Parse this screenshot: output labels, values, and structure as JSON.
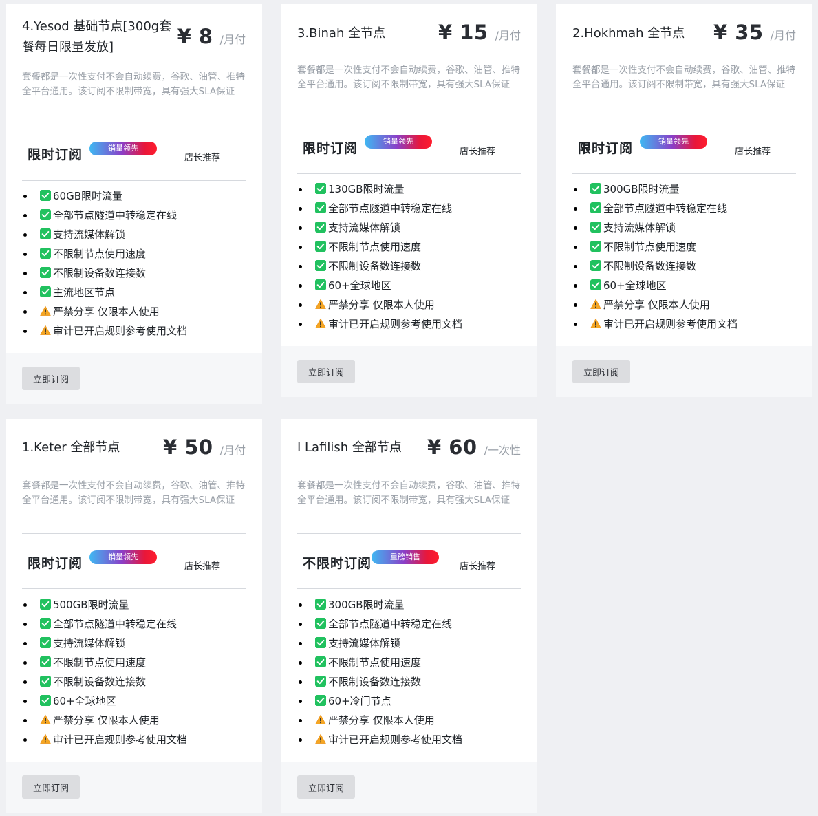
{
  "plans": [
    {
      "title": "4.Yesod 基础节点[300g套餐每日限量发放]",
      "price": "¥ 8",
      "unit": "/月付",
      "description": "套餐都是一次性支付不会自动续费，谷歌、油管、推特全平台通用。该订阅不限制带宽，具有强大SLA保证",
      "promo_label": "限时订阅",
      "badge": "销量领先",
      "recommend": "店长推荐",
      "features": [
        {
          "icon": "check-icon",
          "text": "60GB限时流量"
        },
        {
          "icon": "check-icon",
          "text": "全部节点隧道中转稳定在线"
        },
        {
          "icon": "check-icon",
          "text": "支持流媒体解锁"
        },
        {
          "icon": "check-icon",
          "text": "不限制节点使用速度"
        },
        {
          "icon": "check-icon",
          "text": "不限制设备数连接数"
        },
        {
          "icon": "check-icon",
          "text": "主流地区节点"
        },
        {
          "icon": "warning-icon",
          "text": "严禁分享 仅限本人使用"
        },
        {
          "icon": "warning-icon",
          "text": "审计已开启规则参考使用文档"
        }
      ],
      "button": "立即订阅"
    },
    {
      "title": "3.Binah 全节点",
      "price": "¥ 15",
      "unit": "/月付",
      "description": "套餐都是一次性支付不会自动续费，谷歌、油管、推特全平台通用。该订阅不限制带宽，具有强大SLA保证",
      "promo_label": "限时订阅",
      "badge": "销量领先",
      "recommend": "店长推荐",
      "features": [
        {
          "icon": "check-icon",
          "text": "130GB限时流量"
        },
        {
          "icon": "check-icon",
          "text": "全部节点隧道中转稳定在线"
        },
        {
          "icon": "check-icon",
          "text": "支持流媒体解锁"
        },
        {
          "icon": "check-icon",
          "text": "不限制节点使用速度"
        },
        {
          "icon": "check-icon",
          "text": "不限制设备数连接数"
        },
        {
          "icon": "check-icon",
          "text": "60+全球地区"
        },
        {
          "icon": "warning-icon",
          "text": "严禁分享 仅限本人使用"
        },
        {
          "icon": "warning-icon",
          "text": "审计已开启规则参考使用文档"
        }
      ],
      "button": "立即订阅"
    },
    {
      "title": "2.Hokhmah 全节点",
      "price": "¥ 35",
      "unit": "/月付",
      "description": "套餐都是一次性支付不会自动续费，谷歌、油管、推特全平台通用。该订阅不限制带宽，具有强大SLA保证",
      "promo_label": "限时订阅",
      "badge": "销量领先",
      "recommend": "店长推荐",
      "features": [
        {
          "icon": "check-icon",
          "text": "300GB限时流量"
        },
        {
          "icon": "check-icon",
          "text": "全部节点隧道中转稳定在线"
        },
        {
          "icon": "check-icon",
          "text": "支持流媒体解锁"
        },
        {
          "icon": "check-icon",
          "text": "不限制节点使用速度"
        },
        {
          "icon": "check-icon",
          "text": "不限制设备数连接数"
        },
        {
          "icon": "check-icon",
          "text": "60+全球地区"
        },
        {
          "icon": "warning-icon",
          "text": "严禁分享 仅限本人使用"
        },
        {
          "icon": "warning-icon",
          "text": "审计已开启规则参考使用文档"
        }
      ],
      "button": "立即订阅"
    },
    {
      "title": "1.Keter 全部节点",
      "price": "¥ 50",
      "unit": "/月付",
      "description": "套餐都是一次性支付不会自动续费，谷歌、油管、推特全平台通用。该订阅不限制带宽，具有强大SLA保证",
      "promo_label": "限时订阅",
      "badge": "销量领先",
      "recommend": "店长推荐",
      "features": [
        {
          "icon": "check-icon",
          "text": "500GB限时流量"
        },
        {
          "icon": "check-icon",
          "text": "全部节点隧道中转稳定在线"
        },
        {
          "icon": "check-icon",
          "text": "支持流媒体解锁"
        },
        {
          "icon": "check-icon",
          "text": "不限制节点使用速度"
        },
        {
          "icon": "check-icon",
          "text": "不限制设备数连接数"
        },
        {
          "icon": "check-icon",
          "text": "60+全球地区"
        },
        {
          "icon": "warning-icon",
          "text": "严禁分享 仅限本人使用"
        },
        {
          "icon": "warning-icon",
          "text": "审计已开启规则参考使用文档"
        }
      ],
      "button": "立即订阅"
    },
    {
      "title": "I Lafilish 全部节点",
      "price": "¥ 60",
      "unit": "/一次性",
      "description": "套餐都是一次性支付不会自动续费，谷歌、油管、推特全平台通用。该订阅不限制带宽，具有强大SLA保证",
      "promo_label": "不限时订阅",
      "badge": "重磅销售",
      "recommend": "店长推荐",
      "features": [
        {
          "icon": "check-icon",
          "text": "300GB限时流量"
        },
        {
          "icon": "check-icon",
          "text": "全部节点隧道中转稳定在线"
        },
        {
          "icon": "check-icon",
          "text": "支持流媒体解锁"
        },
        {
          "icon": "check-icon",
          "text": "不限制节点使用速度"
        },
        {
          "icon": "check-icon",
          "text": "不限制设备数连接数"
        },
        {
          "icon": "check-icon",
          "text": "60+冷门节点"
        },
        {
          "icon": "warning-icon",
          "text": "严禁分享 仅限本人使用"
        },
        {
          "icon": "warning-icon",
          "text": "审计已开启规则参考使用文档"
        }
      ],
      "button": "立即订阅"
    }
  ]
}
